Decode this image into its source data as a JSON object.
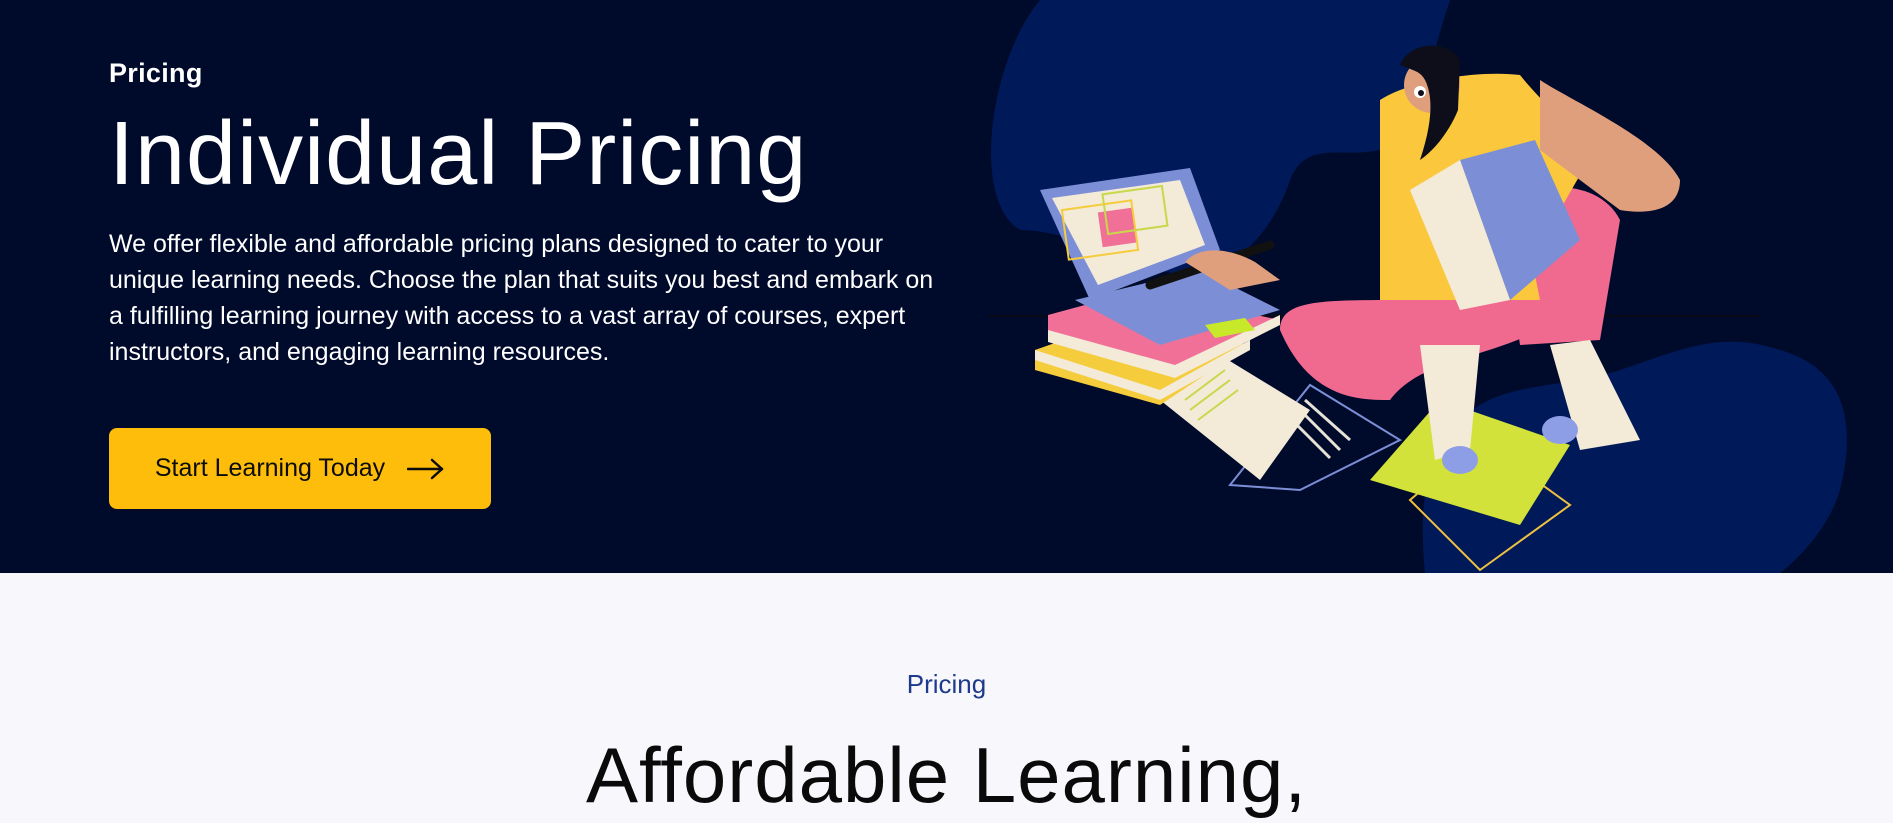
{
  "hero": {
    "eyebrow": "Pricing",
    "title": "Individual Pricing",
    "description": "We offer flexible and affordable pricing plans designed to cater to your unique learning needs. Choose the plan that suits you best and embark on a fulfilling learning journey with access to a vast array of courses, expert instructors, and engaging learning resources.",
    "cta_label": "Start Learning Today",
    "cta_icon": "arrow-right-icon",
    "illustration": "student-studying-with-laptop-and-books"
  },
  "section": {
    "eyebrow": "Pricing",
    "title": "Affordable Learning,"
  },
  "colors": {
    "hero_background": "#000a2b",
    "accent": "#fdbd0a",
    "page_background": "#f8f7fc",
    "eyebrow_blue": "#1d3a8c",
    "blob_blue": "#001a59"
  }
}
